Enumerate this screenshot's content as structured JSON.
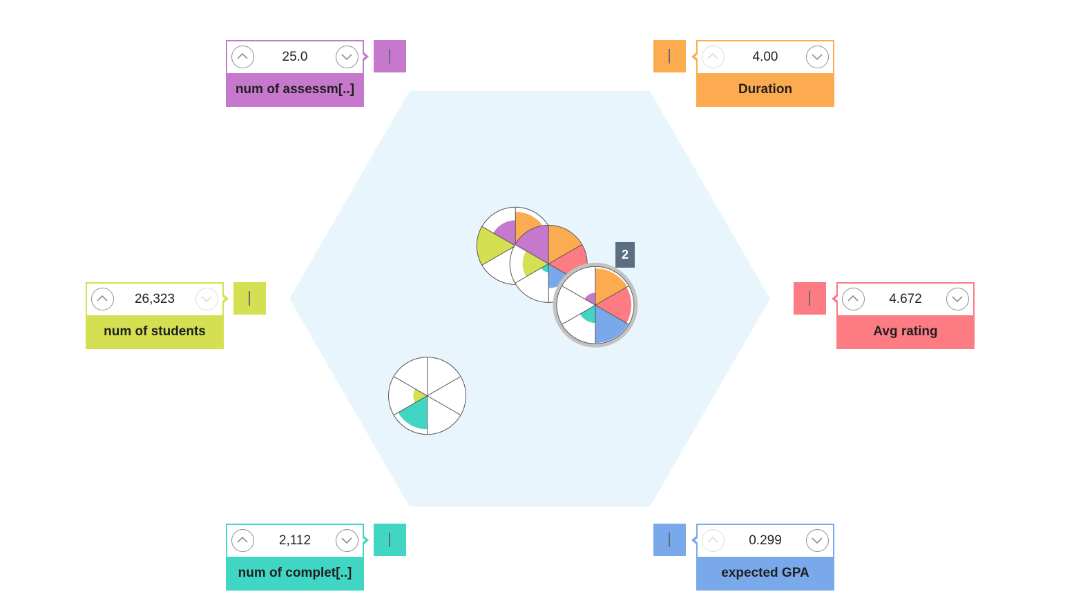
{
  "colors": {
    "assessments": "#c678cd",
    "duration": "#fdab50",
    "rating": "#fd7b82",
    "gpa": "#79a9eb",
    "completions": "#40d6c3",
    "students": "#d4e052",
    "hexagon": "#e9f5fd",
    "badge": "#5b6f80"
  },
  "axes": [
    {
      "key": "assessments",
      "value": "25.0",
      "label": "num of assessm[..]",
      "up_icon": "chevron-up-icon",
      "down_icon": "chevron-down-icon"
    },
    {
      "key": "duration",
      "value": "4.00",
      "label": "Duration",
      "up_icon": "chevron-up-icon",
      "down_icon": "chevron-down-icon"
    },
    {
      "key": "students",
      "value": "26,323",
      "label": "num of students",
      "up_icon": "chevron-up-icon",
      "down_icon": "chevron-down-icon"
    },
    {
      "key": "rating",
      "value": "4.672",
      "label": "Avg rating",
      "up_icon": "chevron-up-icon",
      "down_icon": "chevron-down-icon"
    },
    {
      "key": "completions",
      "value": "2,112",
      "label": "num of complet[..]",
      "up_icon": "chevron-up-icon",
      "down_icon": "chevron-down-icon"
    },
    {
      "key": "gpa",
      "value": "0.299",
      "label": "expected GPA",
      "up_icon": "chevron-up-icon",
      "down_icon": "chevron-down-icon"
    }
  ],
  "glyph_order": [
    "duration",
    "rating",
    "gpa",
    "completions",
    "students",
    "assessments"
  ],
  "items": [
    {
      "id": "item-1",
      "values": [
        0.88,
        0.52,
        0.2,
        0.06,
        1.0,
        0.66
      ]
    },
    {
      "id": "item-2",
      "values": [
        1.0,
        1.0,
        0.63,
        0.22,
        0.67,
        1.0
      ]
    },
    {
      "id": "item-3",
      "values": [
        0.95,
        0.93,
        0.98,
        0.46,
        0.0,
        0.32
      ],
      "selected": true,
      "badge": "2"
    },
    {
      "id": "item-4",
      "values": [
        0.0,
        0.0,
        0.0,
        0.87,
        0.36,
        0.0
      ]
    }
  ]
}
